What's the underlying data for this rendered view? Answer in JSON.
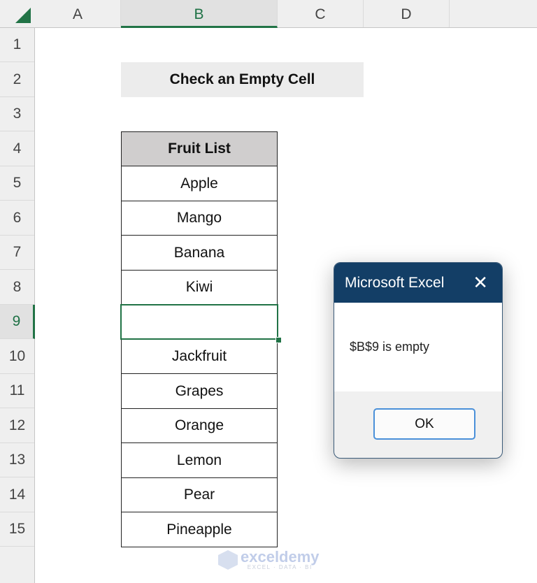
{
  "spreadsheet": {
    "columns": [
      "A",
      "B",
      "C",
      "D",
      ""
    ],
    "selected_column": "B",
    "rows": [
      "1",
      "2",
      "3",
      "4",
      "5",
      "6",
      "7",
      "8",
      "9",
      "10",
      "11",
      "12",
      "13",
      "14",
      "15",
      ""
    ],
    "selected_row": "9",
    "title_cell": "Check an Empty Cell",
    "table_header": "Fruit List",
    "fruits": [
      "Apple",
      "Mango",
      "Banana",
      "Kiwi",
      "",
      "Jackfruit",
      "Grapes",
      "Orange",
      "Lemon",
      "Pear",
      "Pineapple"
    ],
    "active_cell": "B9"
  },
  "dialog": {
    "title": "Microsoft Excel",
    "close_icon": "close-icon",
    "message": "$B$9 is empty",
    "ok_label": "OK"
  },
  "watermark": {
    "name": "exceldemy",
    "tagline": "EXCEL · DATA · BI"
  },
  "colors": {
    "excel_green": "#217346",
    "dialog_title_bg": "#133e66",
    "table_header_bg": "#d0cece",
    "title_bg": "#ececec"
  }
}
